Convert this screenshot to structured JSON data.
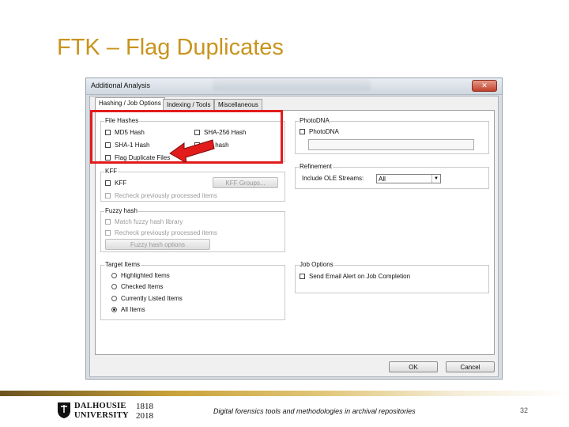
{
  "slide": {
    "title": "FTK – Flag Duplicates",
    "footer_text": "Digital forensics tools and methodologies in archival repositories",
    "page_number": "32",
    "accent_color": "#c8941e"
  },
  "logo": {
    "line1": "DALHOUSIE",
    "line2": "UNIVERSITY",
    "year1": "1818",
    "year2": "2018"
  },
  "window": {
    "title": "Additional Analysis",
    "close_icon": "close-icon"
  },
  "tabs": [
    {
      "label": "Hashing / Job Options",
      "active": true
    },
    {
      "label": "Indexing / Tools",
      "active": false
    },
    {
      "label": "Miscellaneous",
      "active": false
    }
  ],
  "file_hashes": {
    "label": "File Hashes",
    "md5": "MD5 Hash",
    "sha256": "SHA-256 Hash",
    "sha1": "SHA-1 Hash",
    "fuzzy": "zzy hash",
    "flag_duplicates": "Flag Duplicate Files"
  },
  "photodna": {
    "label": "PhotoDNA",
    "checkbox": "PhotoDNA"
  },
  "kff": {
    "label": "KFF",
    "checkbox": "KFF",
    "button": "KFF Groups...",
    "recheck": "Recheck previously processed items"
  },
  "refinement": {
    "label": "Refinement",
    "ole_label": "Include OLE Streams:",
    "ole_value": "All"
  },
  "fuzzy_hash": {
    "label": "Fuzzy hash",
    "match": "Match fuzzy hash library",
    "recheck": "Recheck previously processed items",
    "options_button": "Fuzzy hash options"
  },
  "target_items": {
    "label": "Target Items",
    "options": [
      {
        "label": "Highlighted Items",
        "selected": false
      },
      {
        "label": "Checked Items",
        "selected": false
      },
      {
        "label": "Currently Listed Items",
        "selected": false
      },
      {
        "label": "All Items",
        "selected": true
      }
    ]
  },
  "job_options": {
    "label": "Job Options",
    "email_alert": "Send Email Alert on Job Completion"
  },
  "buttons": {
    "ok": "OK",
    "cancel": "Cancel"
  },
  "highlight_color": "#e21b1b"
}
